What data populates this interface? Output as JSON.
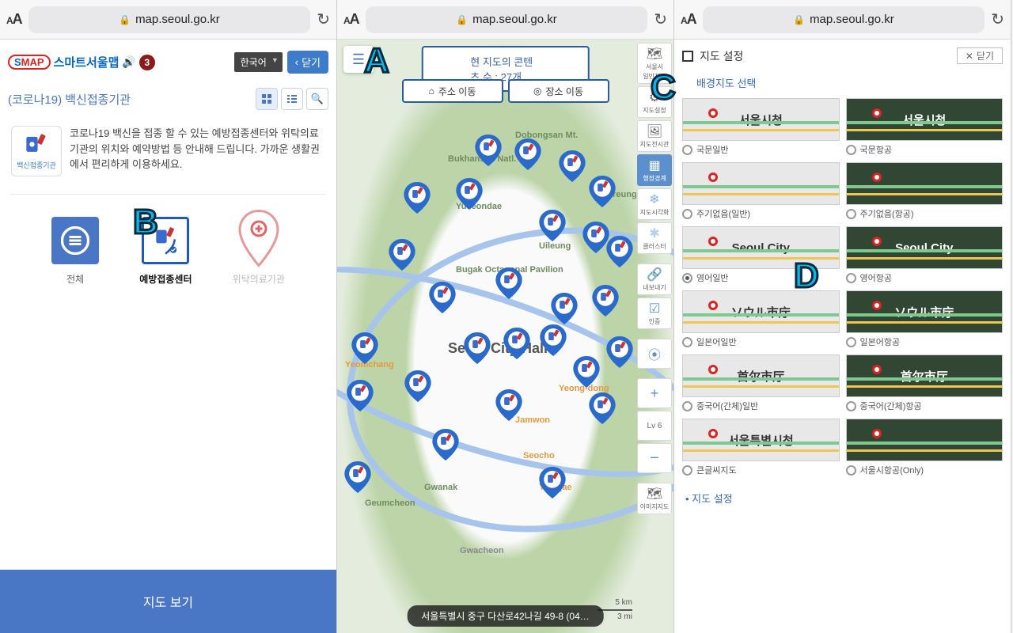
{
  "safari": {
    "url": "map.seoul.go.kr",
    "aa_label": "aA"
  },
  "left": {
    "logo_pill": "SMAP",
    "logo_text": "스마트서울맵",
    "badge_count": "3",
    "lang": "한국어",
    "close_label": "닫기",
    "title": "(코로나19) 백신접종기관",
    "desc": "코로나19 백신을 접종 할 수 있는 예방접종센터와 위탁의료기관의 위치와 예약방법 등 안내해 드립니다. 가까운 생활권에서 편리하게 이용하세요.",
    "icon_caption": "백신접종기관",
    "filters": {
      "all": "전체",
      "center": "예방접종센터",
      "hosp": "위탁의료기관"
    },
    "view_map": "지도 보기"
  },
  "mid": {
    "content_count": "현 지도의 콘텐츠 수 : 27개",
    "move_addr": "주소 이동",
    "move_place": "장소 이동",
    "bottom_addr": "서울특별시 중구 다산로42나길 49-8 (04…",
    "scale_km": "5 km",
    "scale_mi": "3 mi",
    "zoom_level": "Lv 6",
    "side_items": [
      {
        "label": "서울시",
        "label2": "일반지도"
      },
      {
        "label": "지도설정"
      },
      {
        "label": "지도전시관"
      },
      {
        "label": "행정경계"
      },
      {
        "label": "지도시각화"
      },
      {
        "label": "클러스터"
      },
      {
        "label": "내보내기"
      },
      {
        "label": "인증"
      },
      {
        "label": ""
      },
      {
        "label": "+"
      },
      {
        "label": "Lv 6"
      },
      {
        "label": "−"
      },
      {
        "label": "이미지지도"
      }
    ],
    "labels": {
      "seoul": "Seoul City Hall",
      "bugak": "Bugak Octagonal Pavilion",
      "gwanak": "Gwanak",
      "geumcheon": "Geumcheon",
      "gwacheon": "Gwacheon",
      "yangjae": "Yangjae",
      "seocho": "Seocho",
      "jamwon": "Jamwon",
      "uileung": "Uileung",
      "taereung": "Taereung",
      "yuseondae": "Yuseondae",
      "dopongsan": "Dobongsan Mt.",
      "bukhansan": "Bukhansan Natl. Park",
      "yeomchang": "Yeomchang",
      "yeongdong": "Yeong-dong"
    }
  },
  "right": {
    "title": "지도 설정",
    "close": "닫기",
    "title2": "지도 설정",
    "section": "배경지도 선택",
    "options": [
      {
        "label": "국문일반",
        "thumb": "서울시청",
        "dark": false
      },
      {
        "label": "국문항공",
        "thumb": "서울시청",
        "dark": true
      },
      {
        "label": "주기없음(일반)",
        "thumb": "",
        "dark": false
      },
      {
        "label": "주기없음(항공)",
        "thumb": "",
        "dark": true
      },
      {
        "label": "영어일반",
        "thumb": "Seoul City",
        "dark": false,
        "selected": true
      },
      {
        "label": "영어항공",
        "thumb": "Seoul City",
        "dark": true
      },
      {
        "label": "일본어일반",
        "thumb": "ソウル市庁",
        "dark": false
      },
      {
        "label": "일본어항공",
        "thumb": "ソウル市庁",
        "dark": true
      },
      {
        "label": "중국어(간체)일반",
        "thumb": "首尔市厅",
        "dark": false
      },
      {
        "label": "중국어(간체)항공",
        "thumb": "首尔市厅",
        "dark": true
      },
      {
        "label": "큰글씨지도",
        "thumb": "서울특별시청",
        "dark": false
      },
      {
        "label": "서울시항공(Only)",
        "thumb": "",
        "dark": true
      }
    ]
  },
  "callouts": {
    "a": "A",
    "b": "B",
    "c": "C",
    "d": "D"
  }
}
